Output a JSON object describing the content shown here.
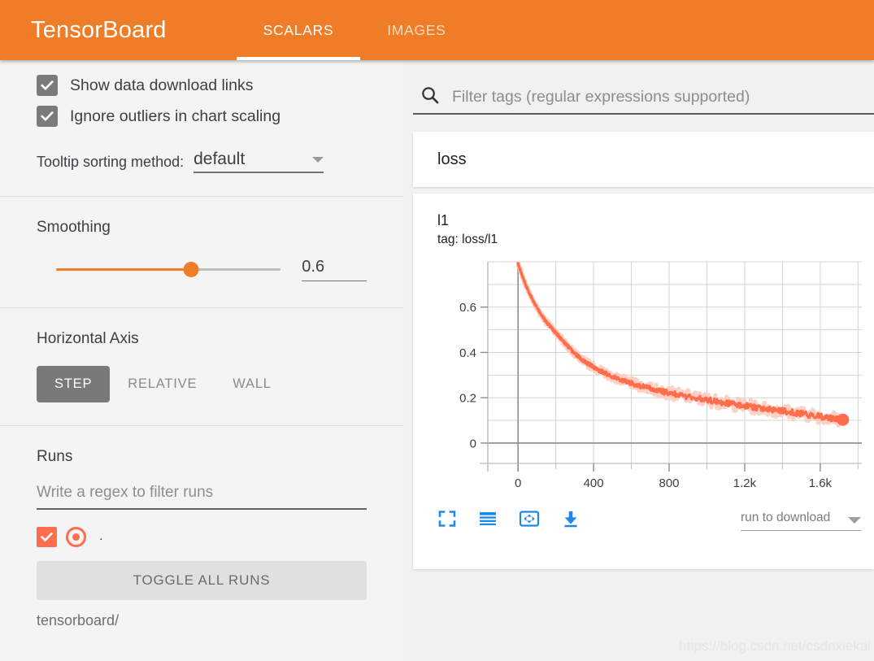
{
  "header": {
    "brand": "TensorBoard",
    "tabs": [
      {
        "label": "SCALARS",
        "active": true
      },
      {
        "label": "IMAGES",
        "active": false
      }
    ]
  },
  "sidebar": {
    "checkboxes": [
      {
        "label": "Show data download links",
        "checked": true
      },
      {
        "label": "Ignore outliers in chart scaling",
        "checked": true
      }
    ],
    "tooltip_sorting": {
      "label": "Tooltip sorting method:",
      "value": "default"
    },
    "smoothing": {
      "title": "Smoothing",
      "value": "0.6",
      "fraction": 0.6
    },
    "horizontal_axis": {
      "title": "Horizontal Axis",
      "options": [
        {
          "label": "STEP",
          "active": true
        },
        {
          "label": "RELATIVE",
          "active": false
        },
        {
          "label": "WALL",
          "active": false
        }
      ]
    },
    "runs": {
      "title": "Runs",
      "filter_placeholder": "Write a regex to filter runs",
      "items": [
        {
          "label": ".",
          "checked": true,
          "color": "#ff6d4d"
        }
      ],
      "toggle_all_label": "TOGGLE ALL RUNS",
      "path": "tensorboard/"
    }
  },
  "main": {
    "filter": {
      "placeholder": "Filter tags (regular expressions supported)",
      "value": ""
    },
    "group_title": "loss",
    "chart_toolbar": {
      "icons": [
        "expand-icon",
        "data-table-icon",
        "fit-domain-icon",
        "download-icon"
      ],
      "download_select": {
        "value": "run to download"
      }
    },
    "watermark": "https://blog.csdn.net/csdnxiekai"
  },
  "colors": {
    "header_orange": "#ef7c26",
    "series": "#ff6d4d",
    "series_faded": "#ffc9ba",
    "accent_blue": "#1e88e5"
  },
  "chart_data": {
    "type": "line",
    "title": "l1",
    "subtitle": "tag: loss/l1",
    "xlabel": "",
    "ylabel": "",
    "xlim": [
      -160,
      1820
    ],
    "ylim": [
      -0.09,
      0.8
    ],
    "grid": true,
    "legend": "none",
    "xticks": [
      0,
      400,
      800,
      1200,
      1600
    ],
    "xticklabels": [
      "0",
      "400",
      "800",
      "1.2k",
      "1.6k"
    ],
    "xminor_step": 200,
    "yticks": [
      0,
      0.2,
      0.4,
      0.6
    ],
    "yticklabels": [
      "0",
      "0.2",
      "0.4",
      "0.6"
    ],
    "yminor_step": 0.1,
    "smoothing": 0.6,
    "end_marker": {
      "x": 1720,
      "y": 0.103
    },
    "series": [
      {
        "name": ".",
        "color": "#ff6d4d",
        "x": [
          0,
          20,
          40,
          60,
          80,
          100,
          120,
          140,
          160,
          180,
          200,
          220,
          240,
          260,
          280,
          300,
          320,
          340,
          360,
          380,
          400,
          440,
          480,
          520,
          560,
          600,
          640,
          680,
          720,
          760,
          800,
          860,
          920,
          980,
          1040,
          1100,
          1160,
          1220,
          1280,
          1340,
          1400,
          1460,
          1520,
          1580,
          1640,
          1680,
          1720
        ],
        "y": [
          0.79,
          0.745,
          0.7,
          0.662,
          0.628,
          0.597,
          0.57,
          0.545,
          0.524,
          0.505,
          0.487,
          0.468,
          0.449,
          0.43,
          0.412,
          0.396,
          0.381,
          0.368,
          0.356,
          0.345,
          0.335,
          0.317,
          0.301,
          0.287,
          0.275,
          0.264,
          0.254,
          0.245,
          0.236,
          0.228,
          0.221,
          0.211,
          0.202,
          0.193,
          0.185,
          0.177,
          0.169,
          0.162,
          0.155,
          0.148,
          0.141,
          0.134,
          0.127,
          0.12,
          0.112,
          0.107,
          0.103
        ]
      }
    ]
  }
}
